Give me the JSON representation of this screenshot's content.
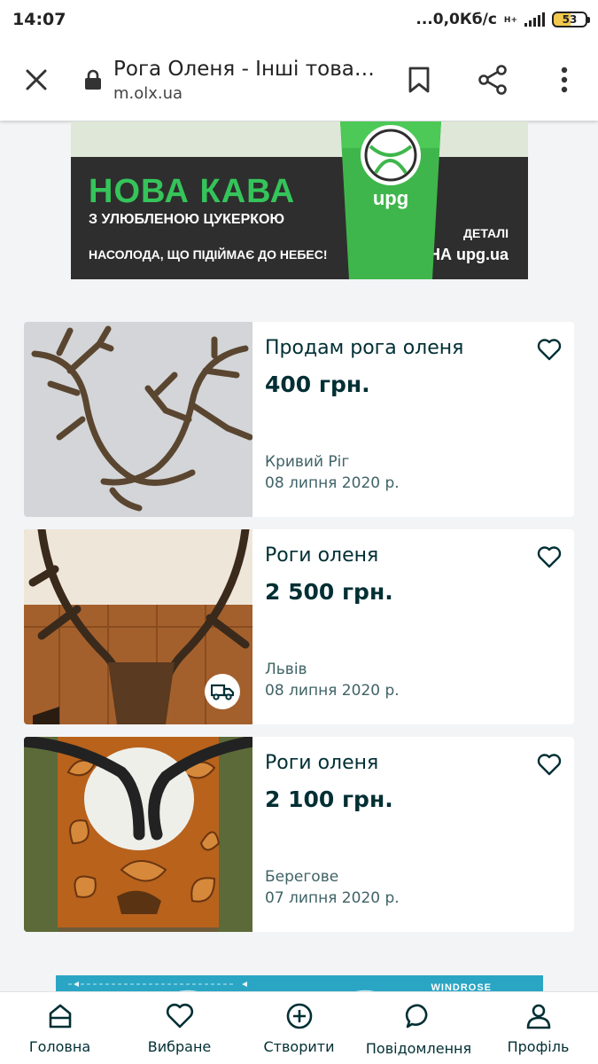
{
  "status_bar": {
    "time": "14:07",
    "network_speed": "...0,0Кб/с",
    "network_type": "H+",
    "battery": "53"
  },
  "browser": {
    "page_title": "Рога Оленя - Інші товари",
    "url": "m.olx.ua",
    "close_icon": "close-icon",
    "lock_icon": "lock-icon",
    "bookmark_icon": "bookmark-icon",
    "share_icon": "share-icon",
    "menu_icon": "more-vertical-icon"
  },
  "ad_banner": {
    "headline": "НОВА КАВА",
    "subheadline": "З УЛЮБЛЕНОЮ ЦУКЕРКОЮ",
    "tagline": "НАСОЛОДА, ЩО ПІДІЙМАЄ ДО НЕБЕС!",
    "cta_line1": "ДЕТАЛІ",
    "cta_line2": "НА upg.ua",
    "brand": "upg"
  },
  "listings": [
    {
      "title": "Продам рога оленя",
      "price": "400 грн.",
      "city": "Кривий Ріг",
      "date": "08 липня 2020 р.",
      "delivery": false
    },
    {
      "title": "Роги оленя",
      "price": "2 500 грн.",
      "city": "Львів",
      "date": "08 липня 2020 р.",
      "delivery": true
    },
    {
      "title": "Роги оленя",
      "price": "2 100 грн.",
      "city": "Берегове",
      "date": "07 липня 2020 р.",
      "delivery": false
    }
  ],
  "bottom_ad": {
    "brand": "WINDROSE"
  },
  "bottom_nav": [
    {
      "label": "Головна",
      "icon": "home-icon"
    },
    {
      "label": "Вибране",
      "icon": "heart-icon"
    },
    {
      "label": "Створити",
      "icon": "plus-circle-icon"
    },
    {
      "label": "Повідомлення",
      "icon": "chat-icon"
    },
    {
      "label": "Профіль",
      "icon": "user-icon"
    }
  ],
  "colors": {
    "brand_dark": "#002f34",
    "background": "#f2f4f5",
    "ad_green": "#35c45a"
  }
}
